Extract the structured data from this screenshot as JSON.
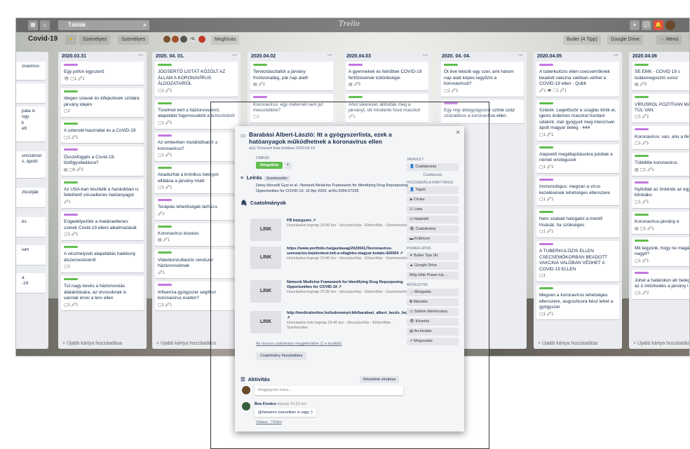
{
  "topbar": {
    "search_label": "Táblák",
    "logo": "Trello",
    "plus": "+",
    "info": "ⓘ",
    "bell": "🔔"
  },
  "board": {
    "name": "Covid-19",
    "star": "★",
    "team_btn": "Személyes",
    "vis_btn": "Személyes",
    "invite": "Meghívás",
    "butler": "Butler (4 Tipp)",
    "drive": "Google Drive",
    "menu": "··· Menü",
    "member_count": "HE"
  },
  "lists": [
    {
      "title": "",
      "cards": [
        "onavirus-",
        "",
        "pata is\nogy\nk\nett",
        "onszámot\ns, ápoló",
        "ztosítják",
        "és",
        "ium",
        "a\n-19"
      ]
    },
    {
      "title": "2020.03.31",
      "cards": [
        {
          "text": "Egy pofon egyszerű",
          "badges": "👁 ▢1 🖉1"
        },
        {
          "text": "Idegen szavak és kifejezések szótára járvány idején",
          "badges": "▢1"
        },
        {
          "text": "A szteroid-használat és a CoViD-19",
          "badges": "▢1 🖉1"
        },
        {
          "text": "Összefüggés a Covid-19-tüdőgyulladásra?",
          "badges": "▤ ▢6 🖉3"
        },
        {
          "text": "Az USA-ban tesztelik a hazánkban is fellelhető vírusellenes hatóanyagot",
          "badges": "🖉1"
        },
        {
          "text": "Engedélyezték a maláriaellenes szerek Covid-19 elleni alkalmazását",
          "badges": "▢1 🖉1"
        },
        {
          "text": "A vészhelyzeti alapellátás hatékony átszervezéséről",
          "badges": "▢1"
        },
        {
          "text": "Túl nagy kevés a háziorvoslás átalakítására, az orvosoknak is vannak érvei a terv ellen",
          "badges": "▢1 🖉1"
        }
      ],
      "add": "+ Újabb kártya hozzáadása"
    },
    {
      "title": "2020. 04. 01.",
      "cards": [
        {
          "text": "JOGSERTŐ LISTÁT KÖZÖLT AZ ÁLLAM A KORONAVÍRUS ÁLDOZATAIRÓL",
          "badges": "▢1 🖉1"
        },
        {
          "text": "Türelmet kért a háziorvosoktól, alapellátó fogorvosoktól a biztosítóktól",
          "badges": "▢1 🖉1"
        },
        {
          "text": "Az emberben mutálódhatott a koronavírus?",
          "badges": "▢1 🖉1"
        },
        {
          "text": "Akadozhat a krónikus betegek ellátása a járvány miatt",
          "badges": "▢1 🖉1"
        },
        {
          "text": "Terápiás lehetőségek tárháza",
          "badges": "🖉1"
        },
        {
          "text": "Koronavírus kisokos",
          "badges": "▤ 🖉1"
        },
        {
          "text": "Videókonzultációs rendszer háziorvosoknak",
          "badges": "🖉1"
        },
        {
          "text": "Influenza-gyógyszer segíthet koronavírus esetén?",
          "badges": "▢1 🖉1"
        }
      ],
      "add": "+ Újabb kártya hozzáadása"
    },
    {
      "title": "2020.04.02",
      "cards": [
        {
          "text": "Tervezdasztaltól a járvány frontvonaláig, pár nap alatt!",
          "badges": "▤ 🖉1"
        },
        {
          "text": "Koronavírus: egy méternél nem jut messzebbre?",
          "badges": "▢1"
        }
      ],
      "add": ""
    },
    {
      "title": "2020.04.03",
      "cards": [
        {
          "text": "A gyermekek és felnőttek COVID-19 fertőzésének különbségei",
          "badges": "▤ 🖉5"
        },
        {
          "text": "Ahol sikeresen állították meg a járványt, ott mindenki hord maszkot",
          "badges": "🖉1"
        }
      ],
      "add": ""
    },
    {
      "title": "2020. 04. 04.",
      "cards": [
        {
          "text": "Öt éve létezik egy szer, ami három nap alatt képes legyőzni a koronavírust?",
          "badges": "▢1 🖉1"
        },
        {
          "text": "Egy régi állatgyógyszer szinte száz százalékos a koronavírus ellen",
          "badges": ""
        }
      ],
      "add": ""
    },
    {
      "title": "2020.04.05",
      "cards": [
        {
          "text": "A tuberkulózis ellen csecsemőknek beadott vakcina valóban véthet a COVID-19 ellen - Qubit",
          "badges": "🖉1 👁 ▢1 🖉1"
        },
        {
          "text": "Szlávik: Legelőször a szaglás tűnik el, igenis érdemes maszkot hordani odakint, már gyógyult meg intenzíven ápolt magyar beteg - 444",
          "badges": "▢1 🖉1"
        },
        {
          "text": "Alapvető megállapításokra jutottak a német virológusok",
          "badges": "▢1 🖉1"
        },
        {
          "text": "Immunológus: megvan a vírus kezelésének lehetséges ellenszere",
          "badges": "▢1 🖉1"
        },
        {
          "text": "Nem szabad halogatni a mentő hívását, ha szükséges",
          "badges": "▢1 🖉1"
        },
        {
          "text": "A TUBERKULÓZIS ELLEN CSECSEMŐKORBAN BEADOTT VAKCINA VALÓBAN VÉDHET A COVID-19 ELLEN",
          "badges": "▢1"
        },
        {
          "text": "Megvan a koronavírus lehetséges ellenszere, augusztusra kész lehet a gyógyszer",
          "badges": "▢1 🖉1"
        }
      ],
      "add": "+ Újabb kártya hozzáadása"
    },
    {
      "title": "2020.04.06",
      "cards": [
        {
          "text": "SE EMK - COVID 19 s tudásmegosztó soroz",
          "badges": "▤ 🖉3"
        },
        {
          "text": "VÍRUSROL POZITÍVAN MÁR ON IS TÚL VAN",
          "badges": "▢1 🖉1"
        },
        {
          "text": "Koronavírus: van, aho a fényt",
          "badges": "▢1 🖉1"
        },
        {
          "text": "Többféle koronavírus",
          "badges": "▤ ▢1 🖉1"
        },
        {
          "text": "Nyilottak az önkénte az egyetemi klinikáko",
          "badges": "▢1 🖉1"
        },
        {
          "text": "Koronavírus-járvány é",
          "badges": "▤ ▢1 🖉1"
        },
        {
          "text": "Mit tegyünk, hogy ne magány a nagyit?",
          "badges": "▢1 🖉1"
        },
        {
          "text": "Johet a határokon átr betegellátás - itt az ü intézkedés a járvány l",
          "badges": "▢1 🖉2"
        }
      ],
      "add": "+ Újabb kártya hozzáadása"
    }
  ],
  "modal": {
    "title": "Barabási Albert-László: Itt a gyógyszerlista, ezek a hatóanyagok működhetnek a koronavírus ellen",
    "subtitle": "a(z) Tervezett lista listában 2020.04.19",
    "labels_h": "CÍMKÉK",
    "label": "Integrálva",
    "desc_h": "Leírás",
    "desc_edit": "Szerkesztés",
    "desc": "Deisy Morselli Gysi et al.: Network Medicine Framework for Identifying Drug Repurposing Opportunities for COVID-19, 15 Apr 2020, arXiv:2004.07229",
    "attach_h": "Csatolmányok",
    "links": [
      {
        "thumb": "LINK",
        "title": "FB bejegyzés ↗",
        "meta": "Hozzáadva tegnap 15:06 kor - Hozzászólás - Eltávolítás - Szerkesztés"
      },
      {
        "thumb": "LINK",
        "title": "https://www.portfolio.hu/gazdasag/20200417/koronavirus-szenzacios-bejelentest-tett-a-vilaghiru-magyar-kutato-426564 ↗",
        "meta": "Hozzáadva tegnap 15:46 kor - Hozzászólás - Eltávolítás - Szerkesztés"
      },
      {
        "thumb": "LINK",
        "title": "Network Medicine Framework for Identifying Drug Repurposing Opportunities for COVID-19 ↗",
        "meta": "Hozzáadva tegnap 15:35 kor - Hozzászólás - Eltávolítás - Szerkesztés"
      },
      {
        "thumb": "LINK",
        "title": "http://medicalonline.hu/tudomany/cikk/barabasi_albert_laszlo_bejelentese ↗",
        "meta": "Hozzáadva már tegnap 15:45 kor - Hozzászólás - Eltávolítás - Szerkesztés"
      }
    ],
    "all_attach": "Az összes csatolmány megjelenítése (1 a további)",
    "add_attach": "Csatolmány hozzáadása",
    "activity_h": "Aktivitás",
    "show_details": "Részletek elrejtése",
    "comment_ph": "Megjegyzés írása...",
    "commenter": "Bea Kovács",
    "comment_time": "tegnap 15:51-kor",
    "comment": "@hetvenro üzenetben is vagy :)",
    "comment_actions": "Válasz - Törlés",
    "side": {
      "add_h": "JAVASOLT",
      "add_items": [
        "Csatlakozás"
      ],
      "join": "Csatlakozás",
      "card_h": "HOZZÁADÁS A KÁRTYÁHOZ",
      "card_items": [
        "Tagok",
        "Címke",
        "Lista",
        "Határidő",
        "Csatolmány",
        "Kritérium"
      ],
      "power_h": "POWER-UPOK",
      "power_items": [
        "Butler Tips (4)",
        "Google Drive",
        "Még több Power-Up ..."
      ],
      "act_h": "MŰVELETEK",
      "act_items": [
        "Mozgatás",
        "Másolás",
        "Sablon létrehozása",
        "Követés",
        "Archiválás",
        "Megosztás"
      ]
    },
    "close": "×"
  }
}
